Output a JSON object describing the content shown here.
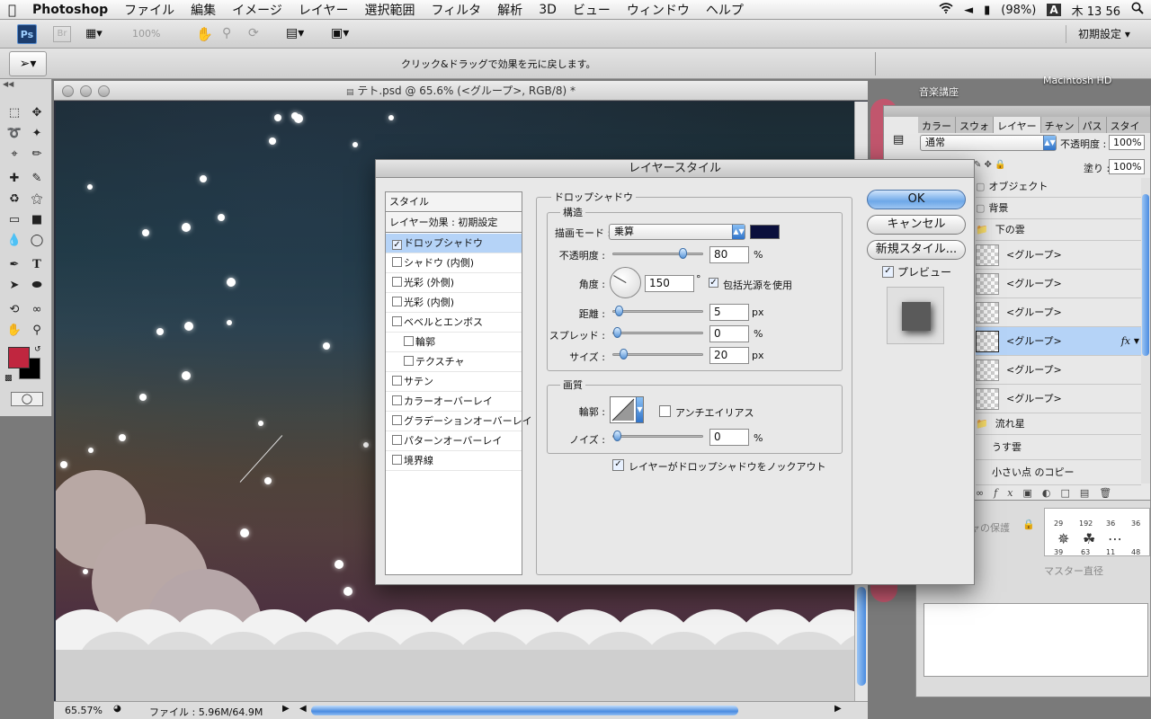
{
  "menubar": {
    "apple": "",
    "app": "Photoshop",
    "items": [
      "ファイル",
      "編集",
      "イメージ",
      "レイヤー",
      "選択範囲",
      "フィルタ",
      "解析",
      "3D",
      "ビュー",
      "ウィンドウ",
      "ヘルプ"
    ],
    "battery": "(98%)",
    "input_method": "A",
    "clock": "木 13 56"
  },
  "appbar": {
    "ps": "Ps",
    "br": "Br",
    "zoom": "100%",
    "workspace": "初期設定"
  },
  "optionsbar": {
    "hint": "クリック&ドラッグで効果を元に戻します。"
  },
  "document": {
    "title": "テト.psd @ 65.6% (<グループ>, RGB/8) *",
    "zoom": "65.57%",
    "fileinfo": "ファイル : 5.96M/64.9M"
  },
  "desktop": {
    "label1": "音楽講座",
    "label2": "Macintosh HD"
  },
  "layers": {
    "tabs": [
      "カラー",
      "スウォ",
      "レイヤー",
      "チャン",
      "パス",
      "スタイ"
    ],
    "blend": "通常",
    "opacity_label": "不透明度 :",
    "opacity": "100%",
    "fill_label": "塗り :",
    "fill": "100%",
    "rows": [
      {
        "name": "オブジェクト",
        "type": "folder"
      },
      {
        "name": "背景",
        "type": "folder"
      },
      {
        "name": "下の雲",
        "type": "folder"
      },
      {
        "name": "<グループ>",
        "type": "layer"
      },
      {
        "name": "<グループ>",
        "type": "layer"
      },
      {
        "name": "<グループ>",
        "type": "layer"
      },
      {
        "name": "<グループ>",
        "type": "layer",
        "selected": true,
        "fx": "fx"
      },
      {
        "name": "<グループ>",
        "type": "layer"
      },
      {
        "name": "<グループ>",
        "type": "layer"
      },
      {
        "name": "流れ星",
        "type": "folder"
      },
      {
        "name": "うす雲",
        "type": "layer"
      },
      {
        "name": "小さい点 のコピー",
        "type": "layer"
      }
    ]
  },
  "brushes": {
    "protect_label": "ャの保護",
    "master_label": "マスター直径",
    "sizes": [
      "29",
      "192",
      "36",
      "36",
      "39",
      "63",
      "11",
      "48"
    ]
  },
  "dialog": {
    "title": "レイヤースタイル",
    "ok": "OK",
    "cancel": "キャンセル",
    "new_style": "新規スタイル...",
    "preview_label": "プレビュー",
    "styles": [
      {
        "label": "スタイル",
        "kind": "header"
      },
      {
        "label": "レイヤー効果 : 初期設定",
        "kind": "header"
      },
      {
        "label": "ドロップシャドウ",
        "kind": "item",
        "checked": true,
        "selected": true
      },
      {
        "label": "シャドウ (内側)",
        "kind": "item"
      },
      {
        "label": "光彩 (外側)",
        "kind": "item"
      },
      {
        "label": "光彩 (内側)",
        "kind": "item"
      },
      {
        "label": "ベベルとエンボス",
        "kind": "item"
      },
      {
        "label": "輪郭",
        "kind": "sub"
      },
      {
        "label": "テクスチャ",
        "kind": "sub"
      },
      {
        "label": "サテン",
        "kind": "item"
      },
      {
        "label": "カラーオーバーレイ",
        "kind": "item"
      },
      {
        "label": "グラデーションオーバーレイ",
        "kind": "item"
      },
      {
        "label": "パターンオーバーレイ",
        "kind": "item"
      },
      {
        "label": "境界線",
        "kind": "item"
      }
    ],
    "section_title": "ドロップシャドウ",
    "structure": {
      "title": "構造",
      "blend_label": "描画モード :",
      "blend_value": "乗算",
      "shadow_color": "#0a0f3c",
      "opacity_label": "不透明度 :",
      "opacity": "80",
      "opacity_fraction": 0.8,
      "opacity_unit": "%",
      "angle_label": "角度 :",
      "angle": "150",
      "angle_deg": 150,
      "angle_unit": "°",
      "global_light": "包括光源を使用",
      "distance_label": "距離 :",
      "distance": "5",
      "distance_unit": "px",
      "spread_label": "スプレッド :",
      "spread": "0",
      "spread_unit": "%",
      "size_label": "サイズ :",
      "size": "20",
      "size_unit": "px"
    },
    "quality": {
      "title": "画質",
      "contour_label": "輪郭 :",
      "antialias": "アンチエイリアス",
      "noise_label": "ノイズ :",
      "noise": "0",
      "noise_unit": "%"
    },
    "knockout": "レイヤーがドロップシャドウをノックアウト"
  }
}
